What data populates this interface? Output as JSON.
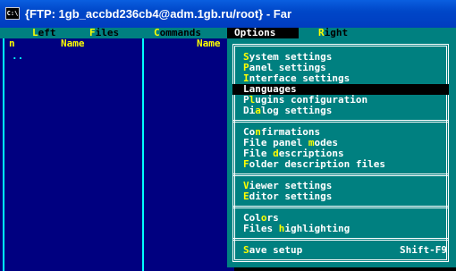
{
  "window": {
    "title": "{FTP: 1gb_accbd236cb4@adm.1gb.ru/root} - Far",
    "icon_text": "C:\\"
  },
  "menubar": {
    "items": [
      {
        "label": "Left",
        "hotkey_index": 0
      },
      {
        "label": "Files",
        "hotkey_index": 0
      },
      {
        "label": "Commands",
        "hotkey_index": 0
      },
      {
        "label": "Options",
        "hotkey_index": 0,
        "active": true
      },
      {
        "label": "Right",
        "hotkey_index": 0
      }
    ]
  },
  "panels": {
    "left_col_stub": "n",
    "left_name_header": "Name",
    "right_name_header": "Name",
    "updir": ".."
  },
  "options_menu": {
    "groups": [
      [
        {
          "label": "System settings",
          "hotkey_index": 0
        },
        {
          "label": "Panel settings",
          "hotkey_index": 0
        },
        {
          "label": "Interface settings",
          "hotkey_index": 0
        },
        {
          "label": "Languages",
          "hotkey_index": 0,
          "selected": true
        },
        {
          "label": "Plugins configuration",
          "hotkey_index": 1
        },
        {
          "label": "Dialog settings",
          "hotkey_index": 2
        }
      ],
      [
        {
          "label": "Confirmations",
          "hotkey_index": 2
        },
        {
          "label": "File panel modes",
          "hotkey_index": 11
        },
        {
          "label": "File descriptions",
          "hotkey_index": 5
        },
        {
          "label": "Folder description files",
          "hotkey_index": 0
        }
      ],
      [
        {
          "label": "Viewer settings",
          "hotkey_index": 0
        },
        {
          "label": "Editor settings",
          "hotkey_index": 0
        }
      ],
      [
        {
          "label": "Colors",
          "hotkey_index": 3
        },
        {
          "label": "Files highlighting",
          "hotkey_index": 6
        }
      ],
      [
        {
          "label": "Save setup",
          "hotkey_index": 0,
          "shortcut": "Shift-F9"
        }
      ]
    ]
  },
  "colors": {
    "panel_bg": "#000080",
    "menu_bg": "#008080",
    "hotkey": "#ffff00",
    "frame": "#00ffff"
  }
}
